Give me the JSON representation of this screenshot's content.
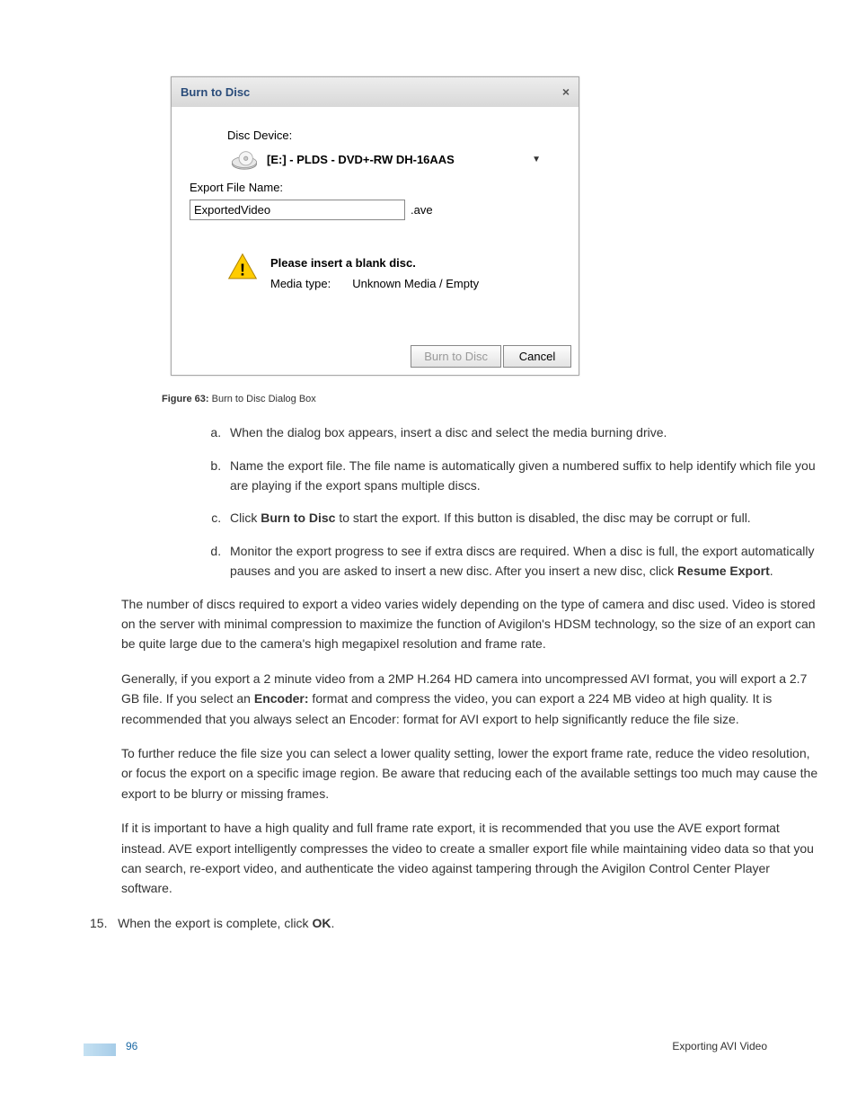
{
  "dialog": {
    "title": "Burn to Disc",
    "discDeviceLabel": "Disc Device:",
    "discDeviceValue": "[E:] - PLDS - DVD+-RW DH-16AAS",
    "exportFileNameLabel": "Export File Name:",
    "exportFileNameValue": "ExportedVideo",
    "extension": ".ave",
    "warnTitle": "Please insert a blank disc.",
    "mediaTypeLabel": "Media type:",
    "mediaTypeValue": "Unknown Media / Empty",
    "burnBtn": "Burn to Disc",
    "cancelBtn": "Cancel"
  },
  "figure": {
    "label": "Figure 63:",
    "caption": "Burn to Disc Dialog Box"
  },
  "steps": {
    "a": "When the dialog box appears, insert a disc and select the media burning drive.",
    "b": "Name the export file. The file name is automatically given a numbered suffix to help identify which file you are playing if the export spans multiple discs.",
    "c_pre": "Click ",
    "c_b": "Burn to Disc",
    "c_post": " to start the export. If this button is disabled, the disc may be corrupt or full.",
    "d_pre": "Monitor the export progress to see if extra discs are required. When a disc is full, the export automatically pauses and you are asked to insert a new disc. After you insert a new disc, click ",
    "d_b": "Resume Export",
    "d_post": "."
  },
  "p1": "The number of discs required to export a video varies widely depending on the type of camera and disc used. Video is stored on the server with minimal compression to maximize the function of Avigilon's HDSM technology, so the size of an export can be quite large due to the camera's high megapixel resolution and frame rate.",
  "p2_pre": "Generally, if you export a 2 minute video from a 2MP H.264 HD camera into uncompressed AVI format, you will export a 2.7 GB file. If you select an ",
  "p2_b": "Encoder:",
  "p2_post": " format and compress the video, you can export a 224 MB video at high quality. It is recommended that you always select an Encoder: format for AVI export to help significantly reduce the file size.",
  "p3": "To further reduce the file size you can select a lower quality setting, lower the export frame rate, reduce the video resolution, or focus the export on a specific image region. Be aware that reducing each of the available settings too much may cause the export to be blurry or missing frames.",
  "p4": "If it is important to have a high quality and full frame rate export, it is recommended that you use the AVE export format instead. AVE export intelligently compresses the video to create a smaller export file while maintaining video data so that you can search, re-export video, and authenticate the video against tampering through the Avigilon Control Center Player software.",
  "step15_num": "15.",
  "step15_pre": "When the export is complete, click ",
  "step15_b": "OK",
  "step15_post": ".",
  "footer": {
    "page": "96",
    "section": "Exporting AVI Video"
  }
}
